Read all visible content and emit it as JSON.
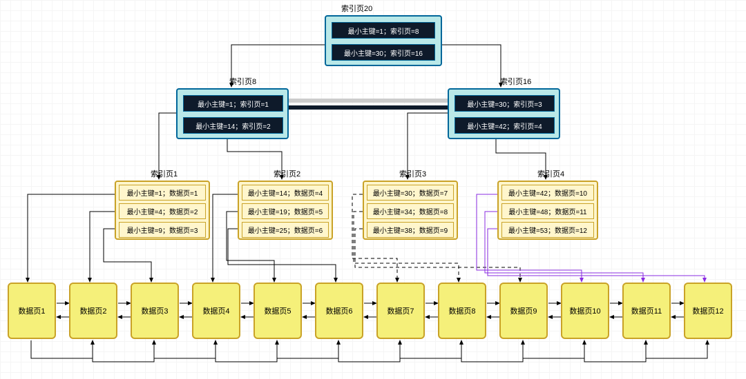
{
  "chart_data": {
    "type": "diagram",
    "description": "B+ tree style index diagram with root index page, two intermediate index pages, four leaf index pages, and twelve data pages linked as a doubly-linked list.",
    "root": {
      "page_label": "索引页20",
      "entries": [
        "最小主键=1；索引页=8",
        "最小主键=30；索引页=16"
      ]
    },
    "intermediate": [
      {
        "page_label": "索引页8",
        "entries": [
          "最小主键=1；索引页=1",
          "最小主键=14；索引页=2"
        ]
      },
      {
        "page_label": "索引页16",
        "entries": [
          "最小主键=30；索引页=3",
          "最小主键=42；索引页=4"
        ]
      }
    ],
    "leaf_index": [
      {
        "page_label": "索引页1",
        "entries": [
          "最小主键=1；数据页=1",
          "最小主键=4；数据页=2",
          "最小主键=9；数据页=3"
        ]
      },
      {
        "page_label": "索引页2",
        "entries": [
          "最小主键=14；数据页=4",
          "最小主键=19；数据页=5",
          "最小主键=25；数据页=6"
        ]
      },
      {
        "page_label": "索引页3",
        "entries": [
          "最小主键=30；数据页=7",
          "最小主键=34；数据页=8",
          "最小主键=38；数据页=9"
        ]
      },
      {
        "page_label": "索引页4",
        "entries": [
          "最小主键=42；数据页=10",
          "最小主键=48；数据页=11",
          "最小主键=53；数据页=12"
        ]
      }
    ],
    "data_pages": [
      "数据页1",
      "数据页2",
      "数据页3",
      "数据页4",
      "数据页5",
      "数据页6",
      "数据页7",
      "数据页8",
      "数据页9",
      "数据页10",
      "数据页11",
      "数据页12"
    ]
  }
}
